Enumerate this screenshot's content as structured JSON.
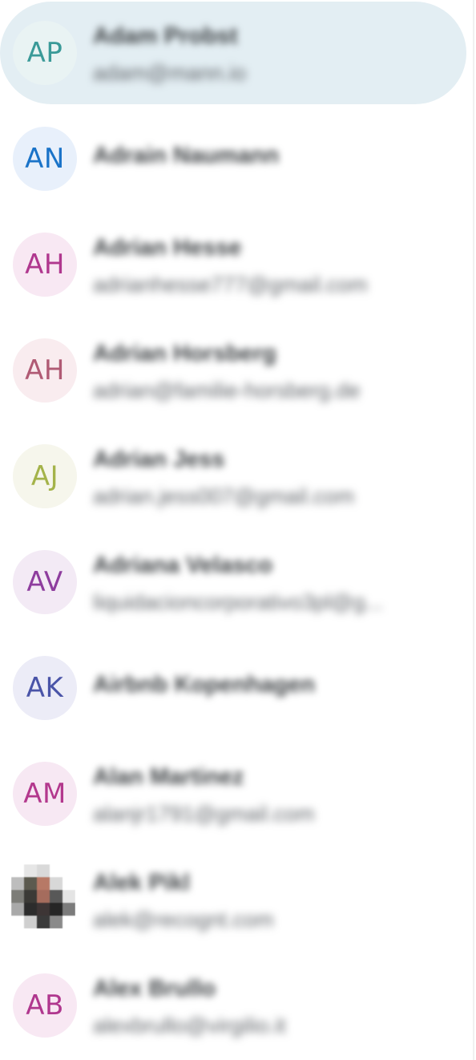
{
  "contacts": [
    {
      "initials": "AP",
      "name": "Adam Probst",
      "email": "adam@mann.io",
      "selected": true,
      "avatar_bg": "#e9f3f3",
      "avatar_fg": "#3a9a98"
    },
    {
      "initials": "AN",
      "name": "Adrain Naumann",
      "email": "",
      "selected": false,
      "avatar_bg": "#e8f0fb",
      "avatar_fg": "#1a73c8"
    },
    {
      "initials": "AH",
      "name": "Adrian Hesse",
      "email": "adrianhesse777@gmail.com",
      "selected": false,
      "avatar_bg": "#f8e8f3",
      "avatar_fg": "#b0378e"
    },
    {
      "initials": "AH",
      "name": "Adrian Horsberg",
      "email": "adrian@familie-horsberg.de",
      "selected": false,
      "avatar_bg": "#f9ecef",
      "avatar_fg": "#b05a74"
    },
    {
      "initials": "AJ",
      "name": "Adrian Jess",
      "email": "adrian.jess007@gmail.com",
      "selected": false,
      "avatar_bg": "#f6f6ec",
      "avatar_fg": "#a4b34a"
    },
    {
      "initials": "AV",
      "name": "Adriana Velasco",
      "email": "liquidacioncorporativo3pl@g...",
      "selected": false,
      "avatar_bg": "#f3eaf5",
      "avatar_fg": "#8e3d9e"
    },
    {
      "initials": "AK",
      "name": "Airbnb Kopenhagen",
      "email": "",
      "selected": false,
      "avatar_bg": "#ececf7",
      "avatar_fg": "#4a54a8"
    },
    {
      "initials": "AM",
      "name": "Alan Martinez",
      "email": "alanjr1791@gmail.com",
      "selected": false,
      "avatar_bg": "#f7e8f3",
      "avatar_fg": "#b3388d"
    },
    {
      "initials": "",
      "name": "Alek Pikl",
      "email": "alek@recognt.com",
      "selected": false,
      "photo": true
    },
    {
      "initials": "AB",
      "name": "Alex Brullo",
      "email": "alexbrullo@virgilio.it",
      "selected": false,
      "avatar_bg": "#f8e8f3",
      "avatar_fg": "#b0378e"
    }
  ]
}
